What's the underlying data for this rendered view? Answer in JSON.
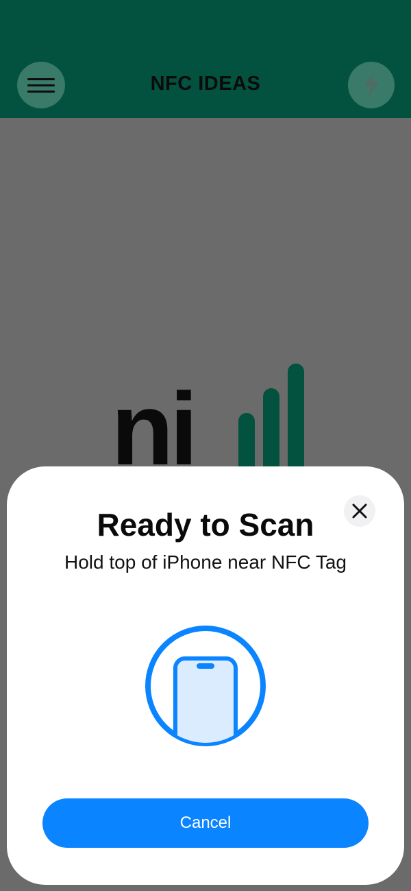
{
  "app": {
    "title": "NFC IDEAS",
    "menu_icon": "hamburger-menu-icon",
    "action_icon": "lightning-bolt-icon",
    "logo_text": "ni",
    "colors": {
      "brand": "#03523f",
      "overlay": "#6b6b6b"
    }
  },
  "scan_sheet": {
    "title": "Ready to Scan",
    "subtitle": "Hold top of iPhone near NFC Tag",
    "close_icon": "close-icon",
    "phone_icon": "iphone-icon",
    "cancel_label": "Cancel",
    "colors": {
      "accent": "#0a84ff",
      "phone_fill": "#dcecff"
    }
  }
}
